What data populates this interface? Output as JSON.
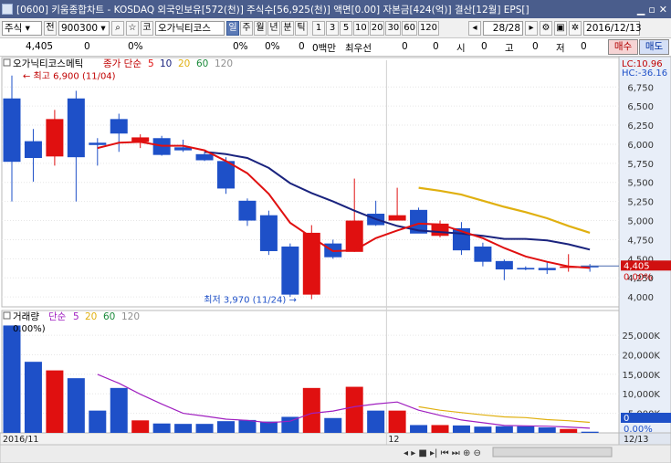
{
  "window": {
    "title": "[0600] 키움종합차트 - KOSDAQ 외국인보유[572(천)] 주식수[56,925(천)] 액면[0.00] 자본금[424(억)] 결산[12월] EPS[]"
  },
  "toolbar": {
    "market_type": "주식",
    "full_label": "전",
    "stock_code": "900300",
    "stock_name": "오가닉티코스",
    "market_badge": "코",
    "period_tabs": [
      "일",
      "주",
      "월",
      "년",
      "분",
      "틱"
    ],
    "active_period": "일",
    "intervals": [
      "1",
      "3",
      "5",
      "10",
      "20",
      "30",
      "60",
      "120"
    ],
    "page_indicator": "28/28",
    "date": "2016/12/13"
  },
  "infobar": {
    "price": "4,405",
    "change": "0",
    "change_pct": "0%",
    "field3": "0%",
    "field4": "0%",
    "field5": "0",
    "field6": "0백만",
    "priority_label": "최우선",
    "field7": "0",
    "field8": "0",
    "open_label": "시",
    "open_val": "0",
    "high_label": "고",
    "high_val": "0",
    "low_label": "저",
    "low_val": "0",
    "buy_button": "매수",
    "sell_button": "매도"
  },
  "price_pane": {
    "title": "오가닉티코스메틱",
    "ma_label": "종가 단순",
    "ma_periods": [
      {
        "label": "5",
        "color": "#e01010"
      },
      {
        "label": "10",
        "color": "#1a237e"
      },
      {
        "label": "20",
        "color": "#e0b010"
      },
      {
        "label": "60",
        "color": "#1a8a3a"
      },
      {
        "label": "120",
        "color": "#909090"
      }
    ],
    "high_annotation": "최고 6,900 (11/04)",
    "low_annotation": "최저 3,970 (11/24)",
    "lc_label": "LC:10.96",
    "hc_label": "HC:-36.16",
    "current_price_tag": "4,405",
    "current_pct_tag": "0.00%"
  },
  "volume_pane": {
    "title": "거래량",
    "ma_label": "단순",
    "ma_periods": [
      {
        "label": "5",
        "color": "#a020c0"
      },
      {
        "label": "20",
        "color": "#e0b010"
      },
      {
        "label": "60",
        "color": "#1a8a3a"
      },
      {
        "label": "120",
        "color": "#909090"
      }
    ],
    "pct_label": "0.00%)",
    "current_tag": "0",
    "current_pct_tag": "0.00%"
  },
  "x_axis": {
    "labels": [
      {
        "index": 0,
        "text": "2016/11"
      },
      {
        "index": 18,
        "text": "12"
      }
    ],
    "right_label": "12/13"
  },
  "colors": {
    "up": "#e01010",
    "down": "#1e50c8",
    "ma5": "#e01010",
    "ma10": "#1a237e",
    "ma20": "#e0b010"
  },
  "chart_data": {
    "type": "candlestick",
    "price_axis": {
      "ticks": [
        4000,
        4250,
        4500,
        4750,
        5000,
        5250,
        5500,
        5750,
        6000,
        6250,
        6500,
        6750
      ],
      "tick_labels": [
        "4,000",
        "4,250",
        "4,500",
        "4,750",
        "5,000",
        "5,250",
        "5,500",
        "5,750",
        "6,000",
        "6,250",
        "6,500",
        "6,750"
      ],
      "range": [
        3870,
        7100
      ]
    },
    "volume_axis": {
      "ticks": [
        5000,
        10000,
        15000,
        20000,
        25000
      ],
      "tick_labels": [
        "5,000K",
        "10,000K",
        "15,000K",
        "20,000K",
        "25,000K"
      ],
      "range": [
        0,
        29000
      ]
    },
    "candles": [
      {
        "o": 6600,
        "h": 6900,
        "l": 5250,
        "c": 5770
      },
      {
        "o": 6040,
        "h": 6200,
        "l": 5510,
        "c": 5820
      },
      {
        "o": 5840,
        "h": 6450,
        "l": 5720,
        "c": 6330
      },
      {
        "o": 6600,
        "h": 6700,
        "l": 5250,
        "c": 5830
      },
      {
        "o": 6020,
        "h": 6080,
        "l": 5720,
        "c": 5990
      },
      {
        "o": 6330,
        "h": 6400,
        "l": 5900,
        "c": 6140
      },
      {
        "o": 6030,
        "h": 6130,
        "l": 5950,
        "c": 6090
      },
      {
        "o": 6080,
        "h": 6110,
        "l": 5850,
        "c": 5860
      },
      {
        "o": 5960,
        "h": 6060,
        "l": 5900,
        "c": 5920
      },
      {
        "o": 5870,
        "h": 5900,
        "l": 5780,
        "c": 5790
      },
      {
        "o": 5780,
        "h": 5830,
        "l": 5350,
        "c": 5420
      },
      {
        "o": 5260,
        "h": 5290,
        "l": 4930,
        "c": 5000
      },
      {
        "o": 5070,
        "h": 5130,
        "l": 4550,
        "c": 4600
      },
      {
        "o": 4660,
        "h": 4700,
        "l": 4000,
        "c": 4030
      },
      {
        "o": 4030,
        "h": 4940,
        "l": 3970,
        "c": 4840
      },
      {
        "o": 4700,
        "h": 4750,
        "l": 4500,
        "c": 4520
      },
      {
        "o": 4590,
        "h": 5550,
        "l": 4590,
        "c": 5000
      },
      {
        "o": 5090,
        "h": 5260,
        "l": 4930,
        "c": 4940
      },
      {
        "o": 5000,
        "h": 5430,
        "l": 5000,
        "c": 5070
      },
      {
        "o": 5140,
        "h": 5170,
        "l": 4850,
        "c": 4830
      },
      {
        "o": 4800,
        "h": 5000,
        "l": 4780,
        "c": 4960
      },
      {
        "o": 4900,
        "h": 4980,
        "l": 4550,
        "c": 4610
      },
      {
        "o": 4660,
        "h": 4710,
        "l": 4400,
        "c": 4460
      },
      {
        "o": 4470,
        "h": 4490,
        "l": 4220,
        "c": 4360
      },
      {
        "o": 4380,
        "h": 4400,
        "l": 4350,
        "c": 4360
      },
      {
        "o": 4380,
        "h": 4450,
        "l": 4300,
        "c": 4350
      },
      {
        "o": 4380,
        "h": 4560,
        "l": 4330,
        "c": 4400
      },
      {
        "o": 4405,
        "h": 4430,
        "l": 4330,
        "c": 4405
      }
    ],
    "ma5": [
      null,
      null,
      null,
      null,
      5950,
      6020,
      6030,
      5980,
      5980,
      5920,
      5780,
      5620,
      5350,
      4970,
      4780,
      4600,
      4610,
      4770,
      4870,
      4960,
      4950,
      4860,
      4770,
      4640,
      4530,
      4460,
      4400,
      4380
    ],
    "ma10": [
      null,
      null,
      null,
      null,
      null,
      null,
      null,
      null,
      null,
      5900,
      5870,
      5820,
      5690,
      5490,
      5360,
      5250,
      5130,
      5020,
      4930,
      4870,
      4850,
      4830,
      4800,
      4760,
      4760,
      4740,
      4690,
      4620
    ],
    "ma20": [
      null,
      null,
      null,
      null,
      null,
      null,
      null,
      null,
      null,
      null,
      null,
      null,
      null,
      null,
      null,
      null,
      null,
      null,
      null,
      5430,
      5390,
      5340,
      5260,
      5180,
      5110,
      5030,
      4930,
      4840
    ],
    "volume": [
      27500,
      18200,
      16000,
      14000,
      5700,
      11500,
      3200,
      2400,
      2300,
      2300,
      3000,
      3300,
      2900,
      4100,
      11500,
      3800,
      11800,
      5700,
      5700,
      2000,
      2000,
      1900,
      1600,
      1700,
      1700,
      1400,
      1000,
      300
    ],
    "vol_ma5": [
      null,
      null,
      null,
      null,
      15000,
      12700,
      9900,
      7400,
      5000,
      4300,
      3500,
      3200,
      2600,
      3000,
      5000,
      5600,
      6700,
      7400,
      7900,
      5800,
      4500,
      3300,
      2600,
      1900,
      1800,
      1700,
      1500,
      1200
    ],
    "vol_ma20": [
      null,
      null,
      null,
      null,
      null,
      null,
      null,
      null,
      null,
      null,
      null,
      null,
      null,
      null,
      null,
      null,
      null,
      null,
      null,
      6700,
      5800,
      5200,
      4600,
      4100,
      3900,
      3400,
      3100,
      2700
    ]
  }
}
